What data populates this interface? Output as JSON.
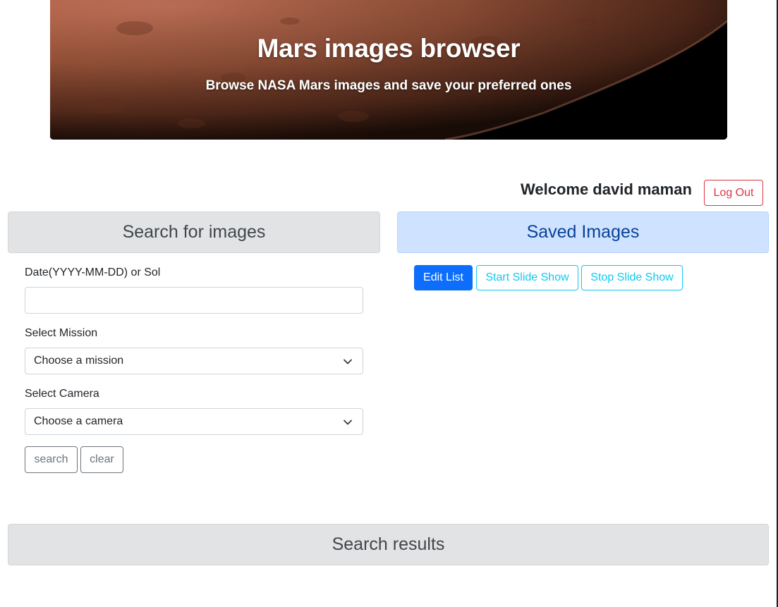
{
  "hero": {
    "title": "Mars images browser",
    "subtitle": "Browse NASA Mars images and save your preferred ones"
  },
  "user": {
    "welcome": "Welcome david maman",
    "logout_label": "Log Out"
  },
  "search_panel": {
    "header": "Search for images",
    "date_label": "Date(YYYY-MM-DD) or Sol",
    "date_value": "",
    "mission_label": "Select Mission",
    "mission_selected": "Choose a mission",
    "camera_label": "Select Camera",
    "camera_selected": "Choose a camera",
    "search_label": "search",
    "clear_label": "clear"
  },
  "saved_panel": {
    "header": "Saved Images",
    "edit_label": "Edit List",
    "start_label": "Start Slide Show",
    "stop_label": "Stop Slide Show"
  },
  "results": {
    "header": "Search results"
  },
  "colors": {
    "primary": "#0d6efd",
    "danger": "#dc3545",
    "info": "#0dcaf0",
    "secondary": "#6c757d",
    "saved_header_bg": "#cfe2ff",
    "saved_header_text": "#084298",
    "neutral_header_bg": "#e2e3e5"
  }
}
